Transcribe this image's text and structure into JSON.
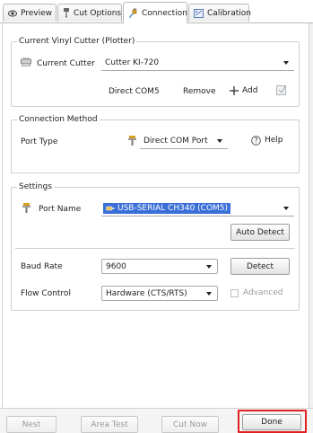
{
  "tabs": [
    {
      "label": "Preview",
      "icon": "eye-icon"
    },
    {
      "label": "Cut Options",
      "icon": "cutter-blade-icon"
    },
    {
      "label": "Connection",
      "icon": "plug-icon",
      "active": true
    },
    {
      "label": "Calibration",
      "icon": "calibration-icon"
    }
  ],
  "cutter_group": {
    "title": "Current Vinyl Cutter (Plotter)",
    "current_cutter_label": "Current Cutter",
    "current_cutter_value": "Cutter KI-720",
    "connection_text": "Direct COM5",
    "remove_label": "Remove",
    "add_label": "Add"
  },
  "connection_method": {
    "title": "Connection Method",
    "port_type_label": "Port Type",
    "port_type_value": "Direct COM Port",
    "help_label": "Help"
  },
  "settings": {
    "title": "Settings",
    "port_name_label": "Port Name",
    "port_name_value": "USB-SERIAL CH340 (COM5)",
    "auto_detect_label": "Auto Detect",
    "baud_rate_label": "Baud Rate",
    "baud_rate_value": "9600",
    "detect_label": "Detect",
    "flow_control_label": "Flow Control",
    "flow_control_value": "Hardware (CTS/RTS)",
    "advanced_label": "Advanced"
  },
  "footer": {
    "nest_label": "Nest",
    "area_test_label": "Area Test",
    "cut_now_label": "Cut Now",
    "done_label": "Done"
  },
  "colors": {
    "accent_selection": "#3a6fd8",
    "highlight_box": "#e02020"
  }
}
